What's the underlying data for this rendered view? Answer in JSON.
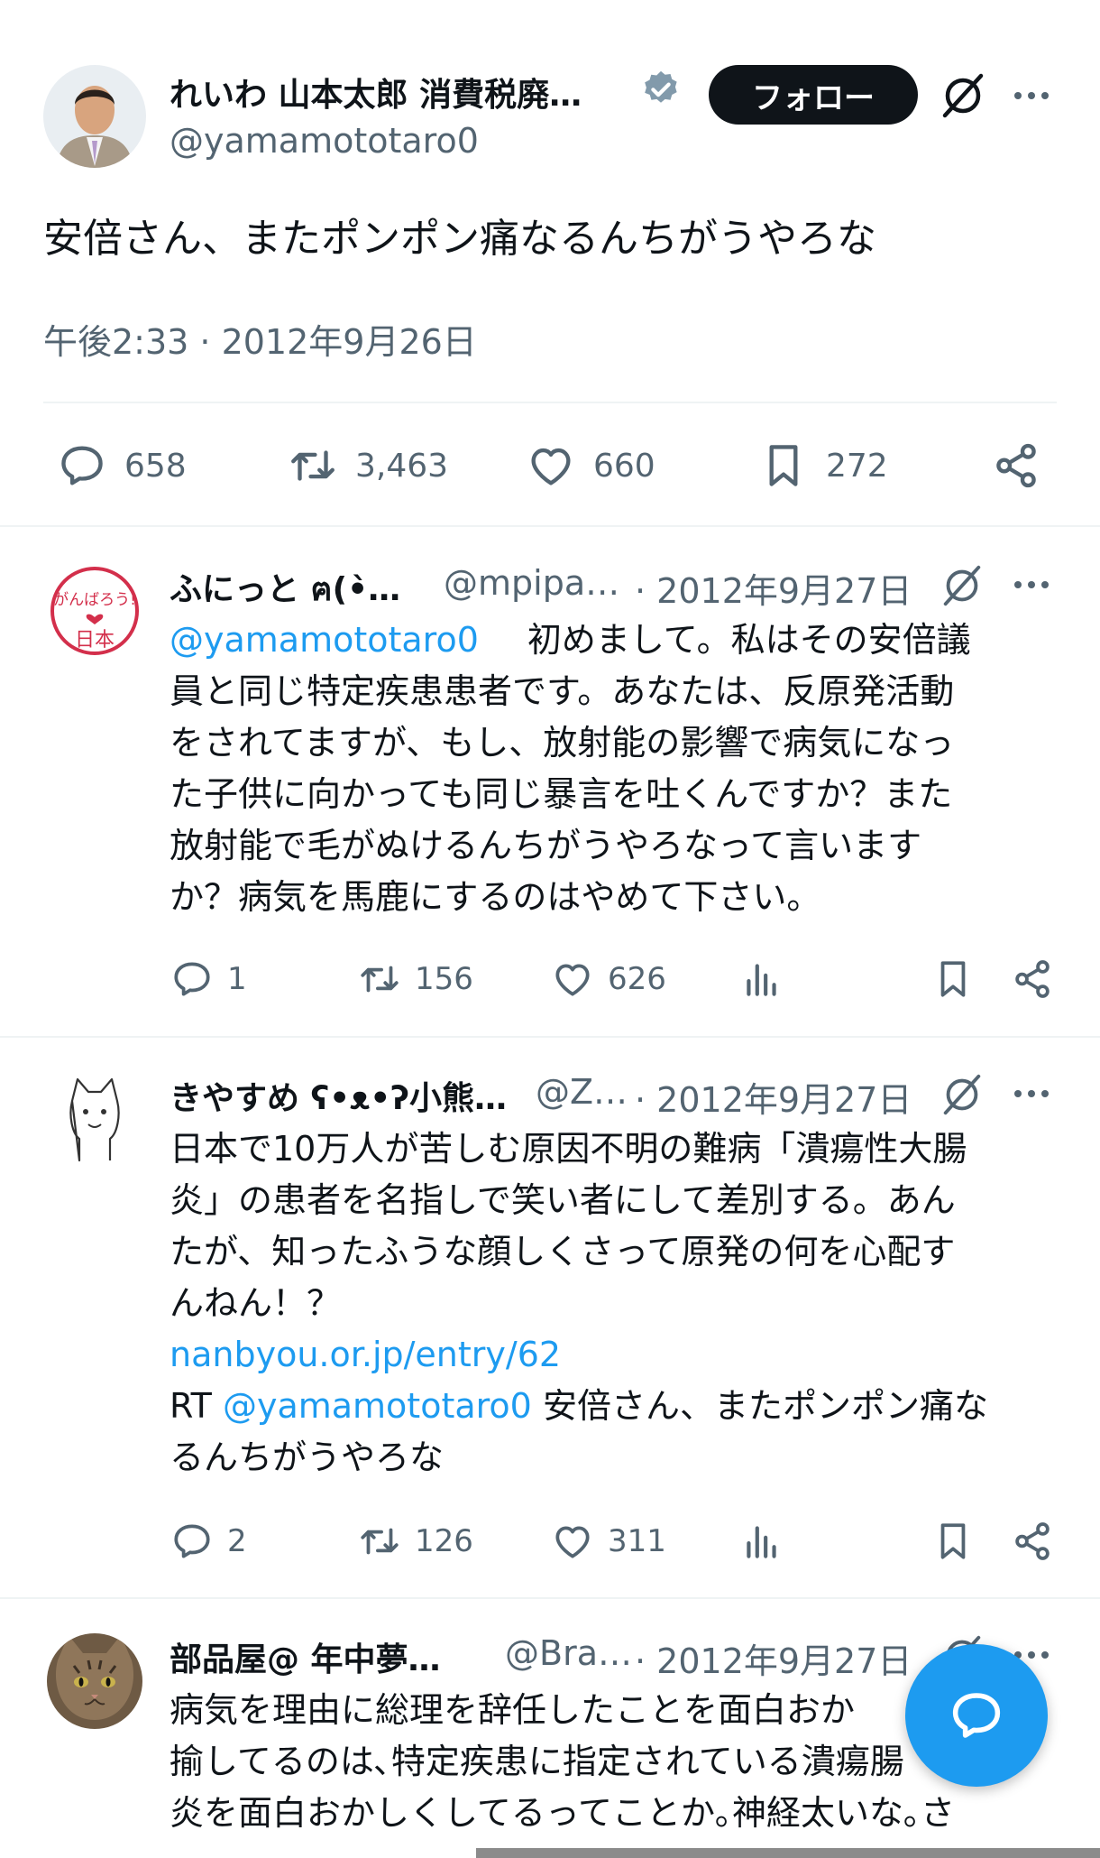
{
  "main_tweet": {
    "author_name": "れいわ 山本太郎 消費税廃…",
    "handle": "@yamamototaro0",
    "follow_label": "フォロー",
    "text": "安倍さん、またポンポン痛なるんちがうやろな",
    "timestamp": "午後2:33 · 2012年9月26日",
    "stats": {
      "replies": "658",
      "retweets": "3,463",
      "likes": "660",
      "bookmarks": "272"
    }
  },
  "replies": [
    {
      "author_name": "ふにっと ฅ(•̀…",
      "handle": "@mpipa…",
      "date": "· 2012年9月27日",
      "mention": "@yamamototaro0",
      "lines": [
        "初めまして。私はその安倍議",
        "員と同じ特定疾患患者です。あなたは、反原発活動",
        "をされてますが、もし、放射能の影響で病気になっ",
        "た子供に向かっても同じ暴言を吐くんですか？また",
        "放射能で毛がぬけるんちがうやろなって言います",
        "か？病気を馬鹿にするのはやめて下さい。"
      ],
      "avatar_text": [
        "がんばろう!",
        "日本"
      ],
      "stats": {
        "replies": "1",
        "retweets": "156",
        "likes": "626"
      }
    },
    {
      "author_name": "きやすめ ʕ•ᴥ•ʔ小熊…",
      "handle": "@Z…",
      "date": "· 2012年9月27日",
      "lines": [
        "日本で10万人が苦しむ原因不明の難病「潰瘍性大腸",
        "炎」の患者を名指しで笑い者にして差別する。あん",
        "たが、知ったふうな顔しくさって原発の何を心配す",
        "んねん！？"
      ],
      "link": "nanbyou.or.jp/entry/62",
      "rt_prefix": "RT",
      "rt_mention": "@yamamototaro0",
      "rt_text_1": "安倍さん、またポンポン痛な",
      "rt_text_2": "るんちがうやろな",
      "stats": {
        "replies": "2",
        "retweets": "126",
        "likes": "311"
      }
    },
    {
      "author_name": "部品屋@ 年中夢…",
      "handle": "@Bra…",
      "date": "· 2012年9月27日",
      "lines": [
        "病気を理由に総理を辞任したことを面白おか",
        "揄してるのは､特定疾患に指定されている潰瘍",
        "炎を面白おかしくしてるってことか｡神経太いな｡さ"
      ],
      "line_tail": "腸"
    }
  ],
  "colors": {
    "accent": "#1d9bf0",
    "text": "#0f1419",
    "muted": "#536471",
    "divider": "#eff3f4"
  }
}
